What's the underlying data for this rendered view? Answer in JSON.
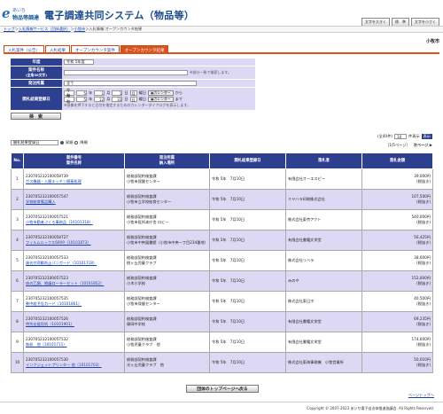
{
  "header": {
    "logo_e": "e",
    "logo_top": "あいち",
    "logo_bottom": "物品等調達",
    "title": "電子調達共同システム（物品等）",
    "font_buttons": [
      "文字を大きく",
      "標　準",
      "文字を小さく"
    ]
  },
  "breadcrumb": {
    "items": [
      "トップ",
      "入札情報サービス（団体選択）",
      "小牧市",
      "入札情報:オープンカウンタ結果"
    ],
    "seps": [
      "＞",
      "＞",
      "＞"
    ]
  },
  "city": "小牧市",
  "tabs": [
    {
      "label": "入札案件（公告）",
      "active": false
    },
    {
      "label": "入札結果",
      "active": false
    },
    {
      "label": "オープンカウンタ案件",
      "active": false
    },
    {
      "label": "オープンカウンタ結果",
      "active": true
    }
  ],
  "form": {
    "year_label": "年度",
    "year_value": "令和 5年度",
    "case_name_label": "案件名称",
    "case_name_sub": "(全角50文字)",
    "case_name_note": "※部分一致で検索します。",
    "dept_label": "発注所属",
    "dept_value": "全て",
    "date_label": "開札結果登録日",
    "date_rows": [
      {
        "era": "令和",
        "y": "5",
        "y_u": "年",
        "m": "1",
        "m_u": "月",
        "d": "1",
        "d_u": "日",
        "dow": "月",
        "dow_u": "曜日",
        "cal": "カレンダー",
        "tail": "から"
      },
      {
        "era": "令和",
        "y": "5",
        "y_u": "年",
        "m": "12",
        "m_u": "月",
        "d": "31",
        "d_u": "日",
        "dow": "日",
        "dow_u": "曜日",
        "cal": "カレンダー",
        "tail": "まで"
      }
    ],
    "date_note": "※画像を押下すると日付を指定するためのカレンダーダイアログを表示します。",
    "search_button": "検　索"
  },
  "sort": {
    "select_value": "開札結果登録日",
    "options": [
      {
        "label": "昇順",
        "checked": true
      },
      {
        "label": "降順",
        "checked": false
      }
    ]
  },
  "count": {
    "prefix": "(全40件)",
    "per_page": "10",
    "unit": "件表示"
  },
  "pager": {
    "page": "［1/5ページ］",
    "next": "次ページ ▶"
  },
  "table": {
    "headers": [
      "No.",
      "案件番号\n案件名称",
      "発注所属\n納入場所",
      "開札結果登録日",
      "落札者",
      "落札金額"
    ],
    "rows": [
      {
        "no": "1",
        "num": "230705232100058739",
        "name": "ガス機器・入間キッチン廃棄処理",
        "dept": "総務部契約検査課",
        "place": "小牧市保健センター",
        "date": "令和 5年　7月10日",
        "winner": "有限会社オーエスピー",
        "amount": "39,000円",
        "tax": "(税抜き)"
      },
      {
        "no": "2",
        "num": "230705232100057547",
        "name": "学校給食備品購入",
        "dept": "総務部契約検査課",
        "place": "小牧市立学校給食センター",
        "date": "令和 5年　7月10日",
        "winner": "ミヤハラ印刷株式会社",
        "amount": "107,500円",
        "tax": "(税抜き)"
      },
      {
        "no": "3",
        "num": "230705232100057521",
        "name": "小牧市勤者ぶくろ事務品（10101318）",
        "dept": "総務部契約検査課",
        "place": "小牧市役所本庁舎 ロビー",
        "date": "令和 5年　7月10日",
        "winner": "株式会社東京アクト",
        "amount": "540,000円",
        "tax": "(税抜き)"
      },
      {
        "no": "4",
        "num": "230705232100058727",
        "name": "フィルムルックス6009（10101873）",
        "dept": "総務部契約検査課",
        "place": "小牧市中央図書館（小牧市中央一丁目234番地）",
        "date": "令和 5年　7月10日",
        "winner": "有限会社書籍文栄堂",
        "amount": "56,425円",
        "tax": "(税抜き)"
      },
      {
        "no": "5",
        "num": "230705232100057533",
        "name": "歯名付荷動防止パンガード（10101718）",
        "dept": "総務部契約検査課",
        "place": "桃ヶ丘児童クラブ",
        "date": "令和 5年　7月10日",
        "winner": "株式会社リベラ",
        "amount": "38,600円",
        "tax": "(税抜き)"
      },
      {
        "no": "6",
        "num": "230705232100057523",
        "name": "体の乙類、根議ローラーセット（10101852）",
        "dept": "総務部契約検査課",
        "place": "小木小学校",
        "date": "令和 5年　7月10日",
        "winner": "みのや",
        "amount": "152,000円",
        "tax": "(税抜き)"
      },
      {
        "no": "7",
        "num": "230705232100057535",
        "name": "勢中総予告カード（10101861）",
        "dept": "総務部契約検査課",
        "place": "小牧市保健センター",
        "date": "令和 5年　7月10日",
        "winner": "株式会社東日ホ",
        "amount": "40,500円",
        "tax": "(税抜き)"
      },
      {
        "no": "8",
        "num": "230705232100057526",
        "name": "特別支援用机（10101901）",
        "dept": "総務部契約検査課",
        "place": "篠岡中学校",
        "date": "令和 5年　7月10日",
        "winner": "有限会社書籍文栄堂",
        "amount": "69,235円",
        "tax": "(税抜き)"
      },
      {
        "no": "9",
        "num": "230705232100057532",
        "name": "和机　他（10101711）",
        "dept": "総務部契約検査課",
        "place": "小牧児童クラブ　他",
        "date": "令和 5年　7月10日",
        "winner": "有限会社書籍文栄堂",
        "amount": "174,000円",
        "tax": "(税抜き)"
      },
      {
        "no": "10",
        "num": "230705232100057530",
        "name": "インクジェットプリンター 他（10101703）",
        "dept": "総務部契約検査課",
        "place": "光ヶ丘児童クラブ　他",
        "date": "令和 5年　7月10日",
        "winner": "株式会社東海事務機　小牧営業所",
        "amount": "50,010円",
        "tax": "(税抜き)"
      }
    ]
  },
  "bottom_button": "団体のトップページへ戻る",
  "page_top": "ページトップへ",
  "footer": "Copyright © 2007-2023 あいち電子自治体推進協議会. All Rights Reserved."
}
